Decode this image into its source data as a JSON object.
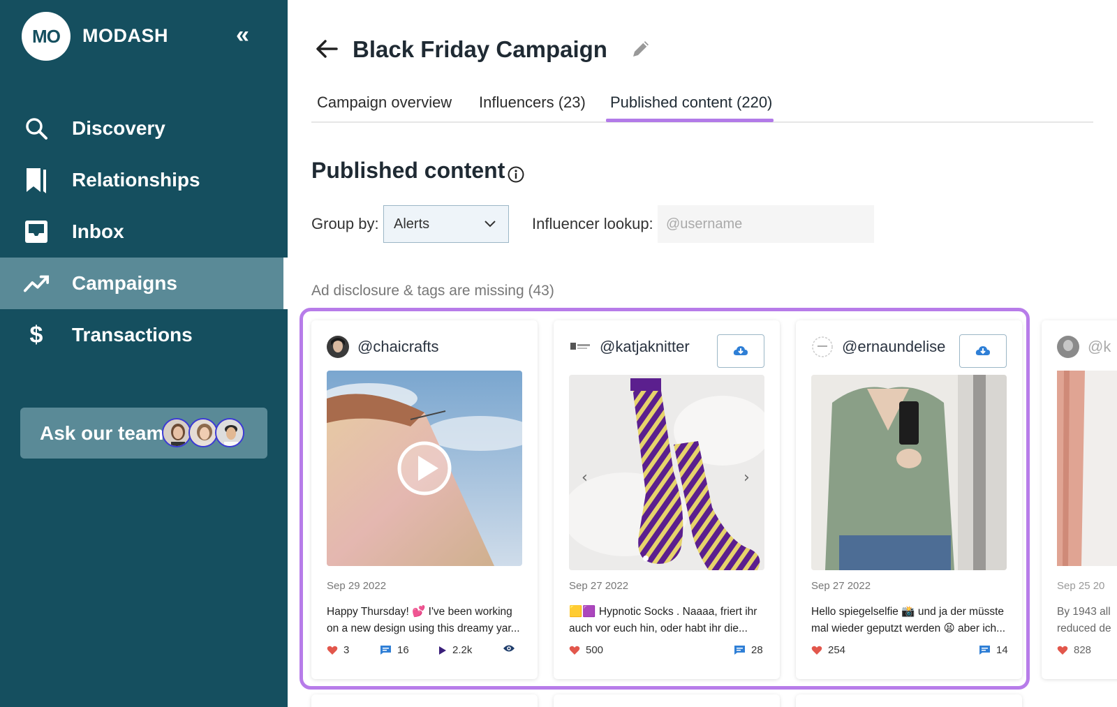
{
  "sidebar": {
    "logo": "MO",
    "brand": "MODASH",
    "collapse": "«",
    "items": [
      {
        "label": "Discovery",
        "icon": "search-icon"
      },
      {
        "label": "Relationships",
        "icon": "bookmark-icon"
      },
      {
        "label": "Inbox",
        "icon": "inbox-icon"
      },
      {
        "label": "Campaigns",
        "icon": "trending-icon",
        "active": true
      },
      {
        "label": "Transactions",
        "icon": "dollar-icon"
      }
    ],
    "ask_team": "Ask our team"
  },
  "header": {
    "title": "Black Friday Campaign"
  },
  "tabs": [
    {
      "label": "Campaign overview"
    },
    {
      "label": "Influencers (23)"
    },
    {
      "label": "Published content (220)",
      "active": true
    }
  ],
  "content": {
    "heading": "Published content",
    "group_by_label": "Group by:",
    "group_by_value": "Alerts",
    "lookup_label": "Influencer lookup:",
    "lookup_placeholder": "@username",
    "section_label": "Ad disclosure & tags are missing (43)"
  },
  "cards": [
    {
      "handle": "@chaicrafts",
      "date": "Sep 29 2022",
      "caption": "Happy Thursday! 💕 I've been working on a new design using this dreamy yar...",
      "likes": "3",
      "comments": "16",
      "plays": "2.2k"
    },
    {
      "handle": "@katjaknitter",
      "date": "Sep 27 2022",
      "caption": "🟨🟪 Hypnotic Socks . Naaaa, friert ihr auch vor euch hin, oder habt ihr die...",
      "likes": "500",
      "comments": "28"
    },
    {
      "handle": "@ernaundelise",
      "date": "Sep 27 2022",
      "caption": "Hello spiegelselfie 📸 und ja der müsste mal wieder geputzt werden 😫 aber ich...",
      "likes": "254",
      "comments": "14"
    },
    {
      "handle": "@k",
      "date": "Sep 25 20",
      "caption": "By 1943 all reduced de",
      "likes": "828"
    }
  ],
  "colors": {
    "sidebar": "#154f5f",
    "sidebar_active": "#5a8a97",
    "accent": "#b77ce9",
    "heart": "#e2574c",
    "comment": "#2f7fd6"
  }
}
